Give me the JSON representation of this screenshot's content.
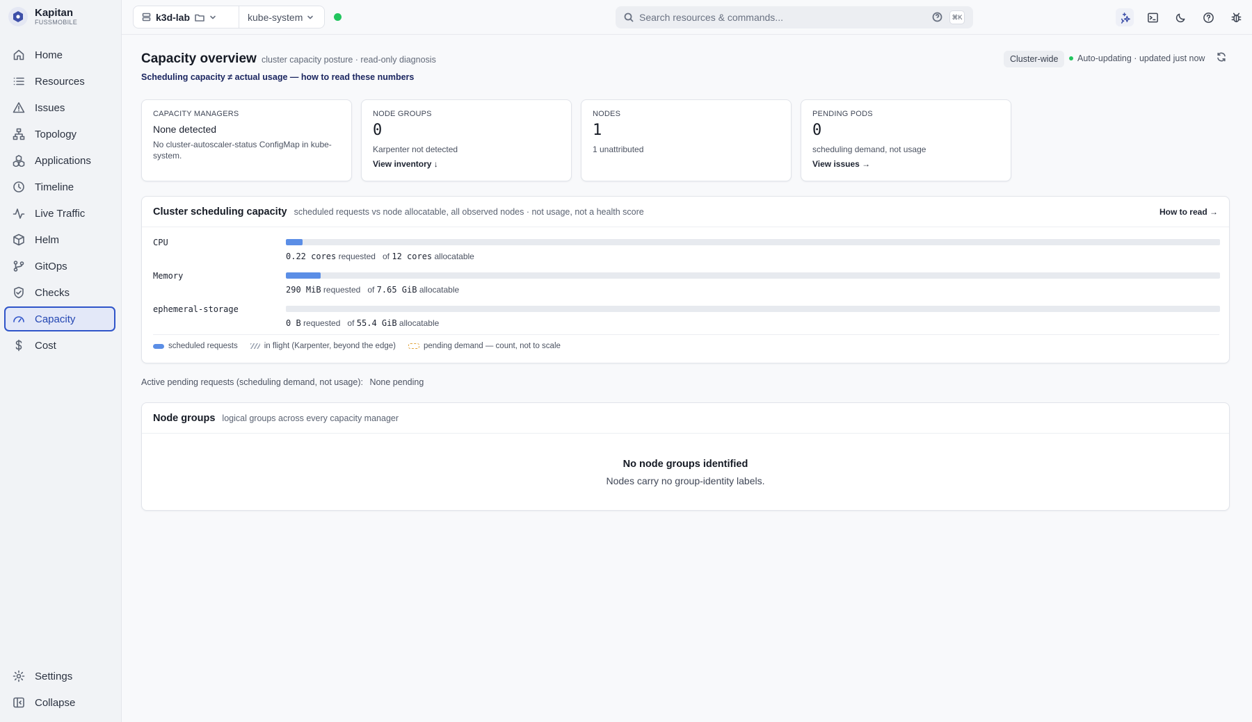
{
  "app": {
    "name": "Kapitan",
    "org": "FUSSMOBILE"
  },
  "sidebar": {
    "items": [
      {
        "label": "Home",
        "icon": "home-icon",
        "active": false
      },
      {
        "label": "Resources",
        "icon": "list-icon",
        "active": false
      },
      {
        "label": "Issues",
        "icon": "warning-triangle-icon",
        "active": false
      },
      {
        "label": "Topology",
        "icon": "topology-icon",
        "active": false
      },
      {
        "label": "Applications",
        "icon": "applications-icon",
        "active": false
      },
      {
        "label": "Timeline",
        "icon": "clock-icon",
        "active": false
      },
      {
        "label": "Live Traffic",
        "icon": "pulse-icon",
        "active": false
      },
      {
        "label": "Helm",
        "icon": "package-icon",
        "active": false
      },
      {
        "label": "GitOps",
        "icon": "git-branch-icon",
        "active": false
      },
      {
        "label": "Checks",
        "icon": "shield-check-icon",
        "active": false
      },
      {
        "label": "Capacity",
        "icon": "gauge-icon",
        "active": true
      },
      {
        "label": "Cost",
        "icon": "dollar-icon",
        "active": false
      }
    ],
    "bottom": [
      {
        "label": "Settings",
        "icon": "gear-icon"
      },
      {
        "label": "Collapse",
        "icon": "collapse-sidebar-icon"
      }
    ]
  },
  "topbar": {
    "cluster": "k3d-lab",
    "namespace": "kube-system",
    "search_placeholder": "Search resources & commands...",
    "shortcut": "⌘K",
    "connection_status_color": "#22c55e"
  },
  "page": {
    "title": "Capacity overview",
    "subtitle": "cluster capacity posture · read-only diagnosis",
    "explain_link": "Scheduling capacity ≠ actual usage — how to read these numbers",
    "scope": "Cluster-wide",
    "auto_update": "Auto-updating · updated just now"
  },
  "cards": {
    "managers": {
      "label": "CAPACITY MANAGERS",
      "value": "None detected",
      "note": "No cluster-autoscaler-status ConfigMap in kube-system."
    },
    "node_groups": {
      "label": "NODE GROUPS",
      "value": "0",
      "note": "Karpenter not detected",
      "link": "View inventory ↓"
    },
    "nodes": {
      "label": "NODES",
      "value": "1",
      "note": "1 unattributed"
    },
    "pending": {
      "label": "PENDING PODS",
      "value": "0",
      "note": "scheduling demand, not usage",
      "link": "View issues →"
    }
  },
  "scheduling": {
    "title": "Cluster scheduling capacity",
    "subtitle": "scheduled requests vs node allocatable, all observed nodes · not usage, not a health score",
    "link": "How to read →",
    "resources": [
      {
        "name": "CPU",
        "requested": "0.22 cores",
        "requested_label": "requested",
        "of_label": "of",
        "allocatable": "12 cores",
        "allocatable_label": "allocatable",
        "fraction": 0.018
      },
      {
        "name": "Memory",
        "requested": "290 MiB",
        "requested_label": "requested",
        "of_label": "of",
        "allocatable": "7.65 GiB",
        "allocatable_label": "allocatable",
        "fraction": 0.037
      },
      {
        "name": "ephemeral-storage",
        "requested": "0 B",
        "requested_label": "requested",
        "of_label": "of",
        "allocatable": "55.4 GiB",
        "allocatable_label": "allocatable",
        "fraction": 0
      }
    ],
    "legend": {
      "scheduled": "scheduled requests",
      "in_flight": "in flight (Karpenter, beyond the edge)",
      "pending": "pending demand — count, not to scale"
    }
  },
  "pending_requests": {
    "label": "Active pending requests (scheduling demand, not usage):",
    "value": "None pending"
  },
  "node_groups": {
    "title": "Node groups",
    "subtitle": "logical groups across every capacity manager",
    "empty_title": "No node groups identified",
    "empty_sub": "Nodes carry no group-identity labels."
  },
  "colors": {
    "accent": "#2f54c9",
    "bar": "#5b8ee6",
    "status_ok": "#22c55e",
    "pending": "#e0a23a"
  }
}
